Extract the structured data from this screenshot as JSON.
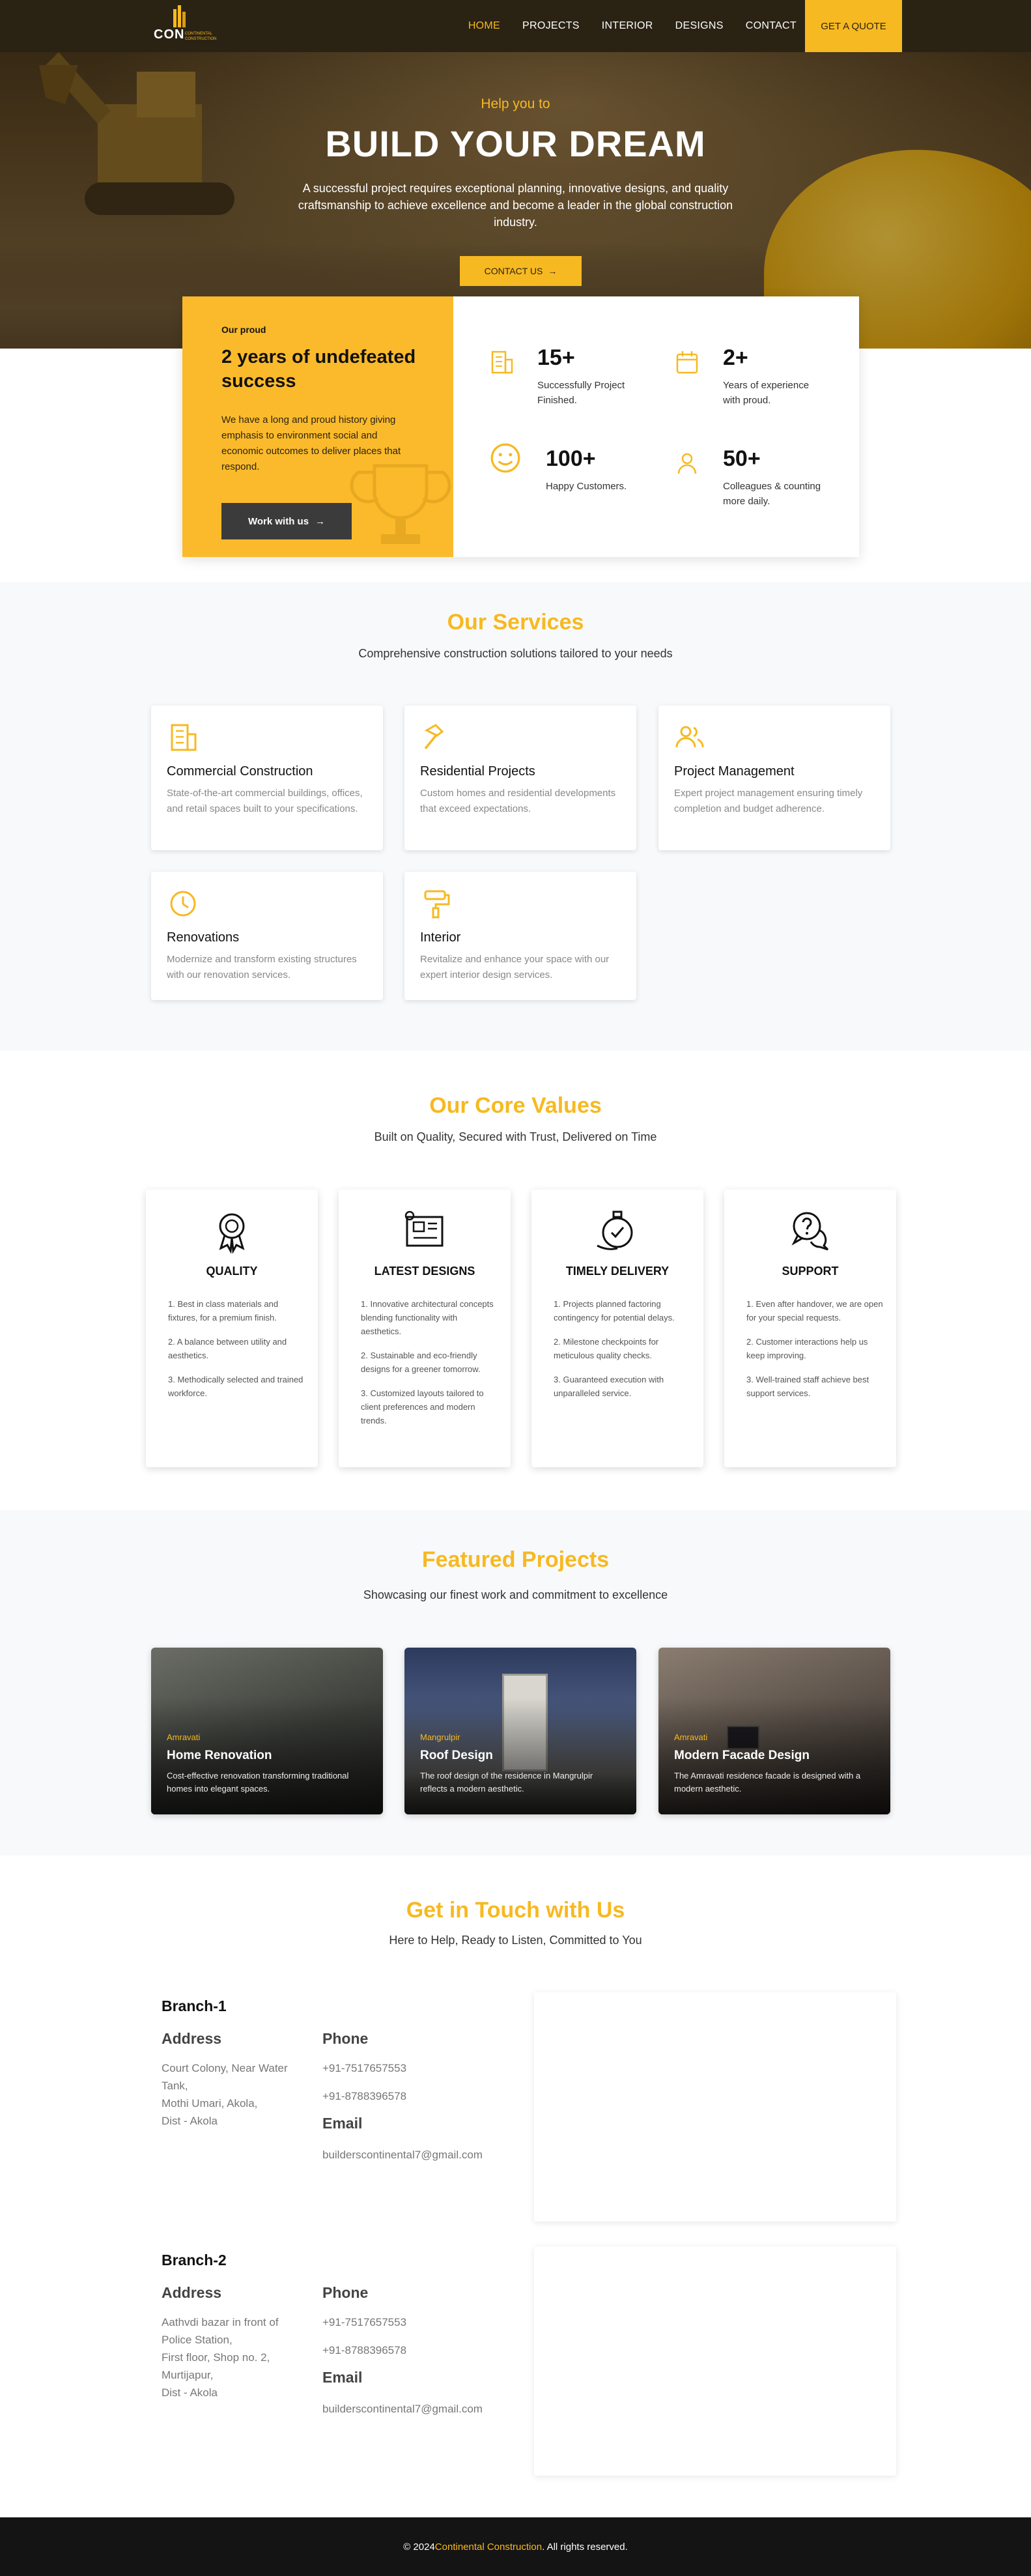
{
  "nav": {
    "logo_word": "CON",
    "logo_sub": "CONTINENTAL CONSTRUCTION",
    "items": [
      {
        "label": "HOME",
        "active": true
      },
      {
        "label": "PROJECTS",
        "active": false
      },
      {
        "label": "INTERIOR",
        "active": false
      },
      {
        "label": "DESIGNS",
        "active": false
      },
      {
        "label": "CONTACT",
        "active": false
      }
    ],
    "quote_label": "GET A QUOTE"
  },
  "hero": {
    "kicker": "Help you to",
    "title": "BUILD YOUR DREAM",
    "text": "A successful project requires exceptional planning, innovative designs, and quality craftsmanship to achieve excellence and become a leader in the global construction industry.",
    "button": "CONTACT US"
  },
  "stats": {
    "proud": "Our proud",
    "headline": "2 years of undefeated success",
    "desc": "We have a long and proud history giving emphasis to environment social and economic outcomes to deliver places that respond.",
    "work_button": "Work with us",
    "items": [
      {
        "num": "15+",
        "label": "Successfully Project Finished.",
        "icon": "building-icon"
      },
      {
        "num": "2+",
        "label": "Years of experience with proud.",
        "icon": "calendar-icon"
      },
      {
        "num": "100+",
        "label": "Happy Customers.",
        "icon": "smile-icon"
      },
      {
        "num": "50+",
        "label": "Colleagues & counting more daily.",
        "icon": "user-icon"
      }
    ]
  },
  "services": {
    "title": "Our Services",
    "subtitle": "Comprehensive construction solutions tailored to your needs",
    "items": [
      {
        "title": "Commercial Construction",
        "text": "State-of-the-art commercial buildings, offices, and retail spaces built to your specifications.",
        "icon": "building-icon"
      },
      {
        "title": "Residential Projects",
        "text": "Custom homes and residential developments that exceed expectations.",
        "icon": "hammer-icon"
      },
      {
        "title": "Project Management",
        "text": "Expert project management ensuring timely completion and budget adherence.",
        "icon": "users-icon"
      },
      {
        "title": "Renovations",
        "text": "Modernize and transform existing structures with our renovation services.",
        "icon": "clock-icon"
      },
      {
        "title": "Interior",
        "text": "Revitalize and enhance your space with our expert interior design services.",
        "icon": "paint-roller-icon"
      }
    ]
  },
  "values": {
    "title": "Our Core Values",
    "subtitle": "Built on Quality, Secured with Trust, Delivered on Time",
    "items": [
      {
        "title": "QUALITY",
        "icon": "quality-badge-icon",
        "points": [
          "1. Best in class materials and fixtures, for a premium finish.",
          "2. A balance between utility and aesthetics.",
          "3. Methodically selected and trained workforce."
        ]
      },
      {
        "title": "LATEST DESIGNS",
        "icon": "blueprint-icon",
        "points": [
          "1. Innovative architectural concepts blending functionality with aesthetics.",
          "2. Sustainable and eco-friendly designs for a greener tomorrow.",
          "3. Customized layouts tailored to client preferences and modern trends."
        ]
      },
      {
        "title": "TIMELY DELIVERY",
        "icon": "stopwatch-icon",
        "points": [
          "1. Projects planned factoring contingency for potential delays.",
          "2. Milestone checkpoints for meticulous quality checks.",
          "3. Guaranteed execution with unparalleled service."
        ]
      },
      {
        "title": "SUPPORT",
        "icon": "support-chat-icon",
        "points": [
          "1. Even after handover, we are open for your special requests.",
          "2. Customer interactions help us keep improving.",
          "3. Well-trained staff achieve best support services."
        ]
      }
    ]
  },
  "projects": {
    "title": "Featured Projects",
    "subtitle": "Showcasing our finest work and commitment to excellence",
    "items": [
      {
        "location": "Amravati",
        "title": "Home Renovation",
        "text": "Cost-effective renovation transforming traditional homes into elegant spaces.",
        "color": "#4a4c46"
      },
      {
        "location": "Mangrulpir",
        "title": "Roof Design",
        "text": "The roof design of the residence in Mangrulpir reflects a modern aesthetic.",
        "color": "#3c4a6a"
      },
      {
        "location": "Amravati",
        "title": "Modern Facade Design",
        "text": "The Amravati residence facade is designed with a modern aesthetic.",
        "color": "#5b5149"
      }
    ]
  },
  "contact": {
    "title": "Get in Touch with Us",
    "subtitle": "Here to Help, Ready to Listen, Committed to You",
    "address_h": "Address",
    "phone_h": "Phone",
    "email_h": "Email",
    "branches": [
      {
        "name": "Branch-1",
        "address": [
          "Court Colony, Near Water Tank,",
          "Mothi Umari, Akola,",
          "Dist - Akola"
        ],
        "phones": [
          "+91-7517657553",
          "+91-8788396578"
        ],
        "email": "builderscontinental7@gmail.com"
      },
      {
        "name": "Branch-2",
        "address": [
          "Aathvdi bazar in front of Police Station,",
          "First floor, Shop no. 2,",
          "Murtijapur,",
          "Dist - Akola"
        ],
        "phones": [
          "+91-7517657553",
          "+91-8788396578"
        ],
        "email": "builderscontinental7@gmail.com"
      }
    ]
  },
  "footer": {
    "prefix": "© 2024 ",
    "brand": "Continental Construction",
    "suffix": ". All rights reserved."
  }
}
